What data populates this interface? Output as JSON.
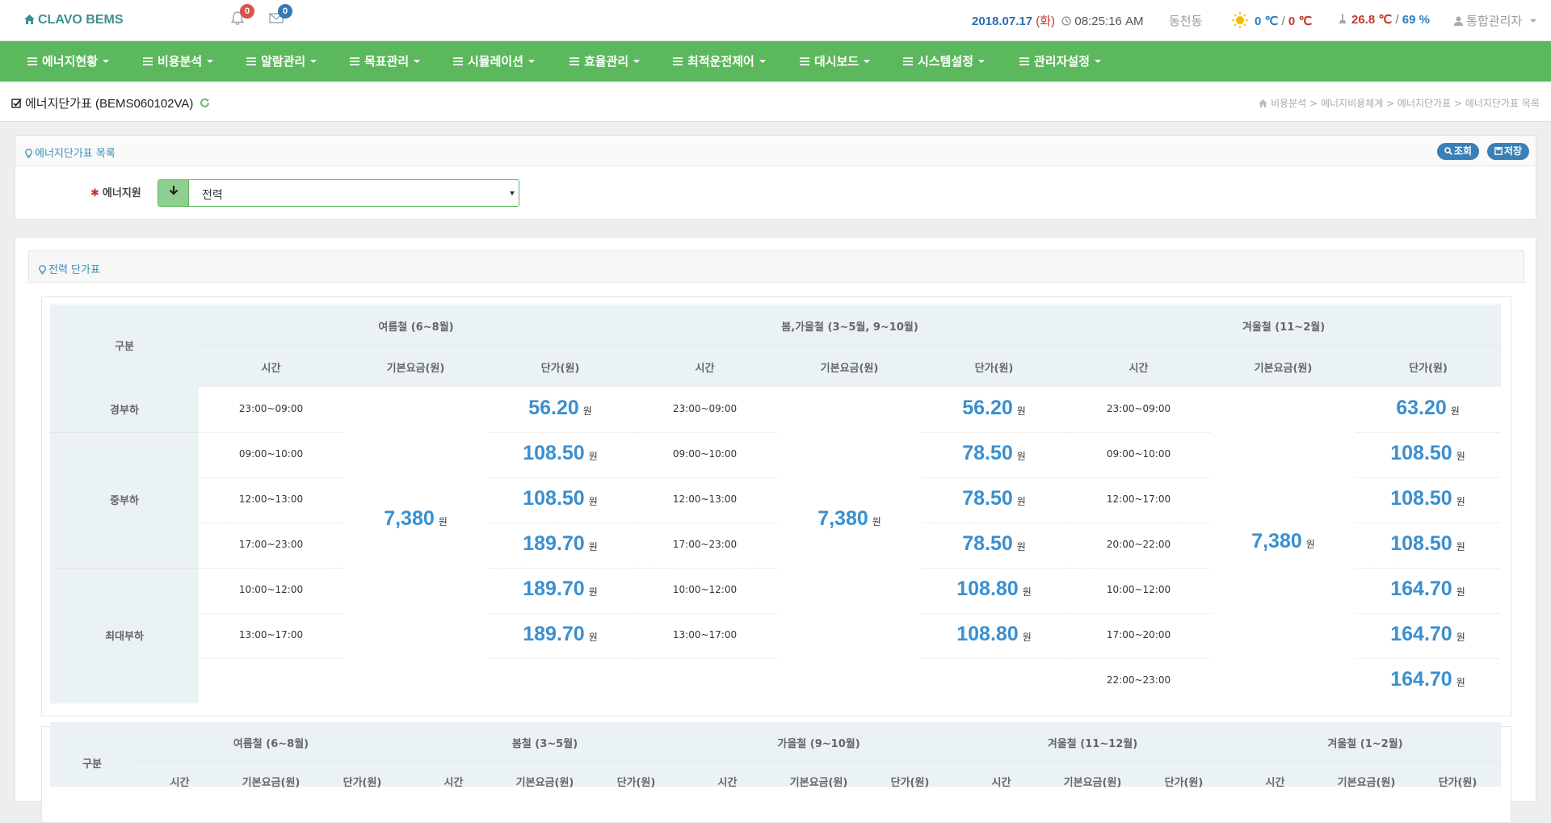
{
  "header": {
    "brand": "CLAVO BEMS",
    "alarm_count": "0",
    "message_count": "0",
    "date": "2018.07.17",
    "dow": "(화)",
    "time": "08:25:16 AM",
    "location": "동천동",
    "outdoor_temp_1": "0 ℃",
    "outdoor_sep": "/",
    "outdoor_temp_2": "0 ℃",
    "indoor_temp": "26.8 ℃",
    "indoor_sep": "/",
    "indoor_humidity": "69 %",
    "user": "통합관리자"
  },
  "nav": [
    "에너지현황",
    "비용분석",
    "알람관리",
    "목표관리",
    "시뮬레이션",
    "효율관리",
    "최적운전제어",
    "대시보드",
    "시스템설정",
    "관리자설정"
  ],
  "page": {
    "title": "에너지단가표 (BEMS060102VA)",
    "breadcrumb": "비용분석 > 에너지비용체계 > 에너지단가표 > 에너지단가표 목록"
  },
  "search_panel": {
    "title": "에너지단가표 목록",
    "search_btn": "조회",
    "save_btn": "저장",
    "field_label": "에너지원",
    "field_value": "전력"
  },
  "table_panel": {
    "title": "전력 단가표",
    "category_header": "구분",
    "seasons": [
      "여름철 (6~8월)",
      "봄,가을철 (3~5월, 9~10월)",
      "겨울철 (11~2월)"
    ],
    "sub_headers": [
      "시간",
      "기본요금(원)",
      "단가(원)"
    ],
    "currency": "원",
    "categories": [
      "경부하",
      "중부하",
      "최대부하"
    ],
    "base_fee": "7,380",
    "rows": [
      {
        "s1_time": "23:00~09:00",
        "s1_price": "56.20",
        "s2_time": "23:00~09:00",
        "s2_price": "56.20",
        "s3_time": "23:00~09:00",
        "s3_price": "63.20"
      },
      {
        "s1_time": "09:00~10:00",
        "s1_price": "108.50",
        "s2_time": "09:00~10:00",
        "s2_price": "78.50",
        "s3_time": "09:00~10:00",
        "s3_price": "108.50"
      },
      {
        "s1_time": "12:00~13:00",
        "s1_price": "108.50",
        "s2_time": "12:00~13:00",
        "s2_price": "78.50",
        "s3_time": "12:00~17:00",
        "s3_price": "108.50"
      },
      {
        "s1_time": "17:00~23:00",
        "s1_price": "189.70",
        "s2_time": "17:00~23:00",
        "s2_price": "78.50",
        "s3_time": "20:00~22:00",
        "s3_price": "108.50"
      },
      {
        "s1_time": "10:00~12:00",
        "s1_price": "189.70",
        "s2_time": "10:00~12:00",
        "s2_price": "108.80",
        "s3_time": "10:00~12:00",
        "s3_price": "164.70"
      },
      {
        "s1_time": "13:00~17:00",
        "s1_price": "189.70",
        "s2_time": "13:00~17:00",
        "s2_price": "108.80",
        "s3_time": "17:00~20:00",
        "s3_price": "164.70"
      },
      {
        "s1_time": "",
        "s1_price": "",
        "s2_time": "",
        "s2_price": "",
        "s3_time": "22:00~23:00",
        "s3_price": "164.70"
      }
    ]
  },
  "table2": {
    "category_header": "구분",
    "seasons": [
      "여름철 (6~8월)",
      "봄철 (3~5월)",
      "가을철 (9~10월)",
      "겨울철 (11~12월)",
      "겨울철 (1~2월)"
    ],
    "sub_headers": [
      "시간",
      "기본요금(원)",
      "단가(원)"
    ]
  }
}
